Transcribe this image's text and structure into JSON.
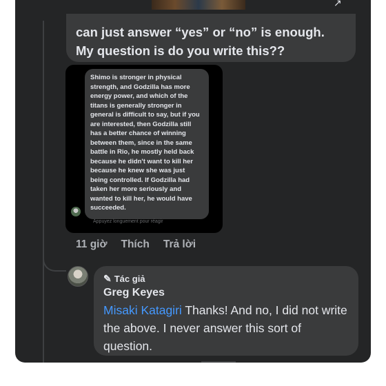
{
  "top_comment": {
    "line1": "can just answer “yes” or “no” is enough.",
    "line2": "My question is do you write this??"
  },
  "screenshot": {
    "text": "Shimo is stronger in physical strength, and Godzilla has more energy power, and which of the titans is generally stronger in general is difficult to say, but if you are interested, then Godzilla still has a better chance of winning between them, since in the same battle in  Rio, he mostly held back because he didn't want to kill her because he knew she was just being controlled.  If Godzilla had taken her more seriously and wanted to kill her, he would have succeeded.",
    "hint": "Appuyez longuement pour réagir"
  },
  "actions": {
    "time": "11 giờ",
    "like": "Thích",
    "reply": "Trả lời"
  },
  "reply": {
    "badge": "Tác giả",
    "author": "Greg Keyes",
    "mention": "Misaki Katagiri",
    "text": " Thanks! And no, I did not write the above. I never answer this sort of question."
  },
  "icons": {
    "author_badge": "pencil-icon"
  },
  "colors": {
    "background": "#242526",
    "bubble": "#3a3b3c",
    "text": "#e4e6eb",
    "muted": "#b0b3b8",
    "mention": "#4599ff"
  }
}
